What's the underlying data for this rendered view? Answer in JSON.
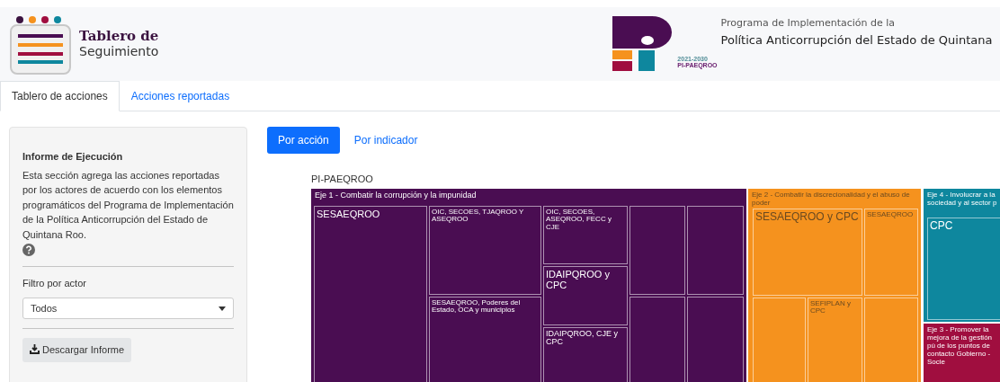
{
  "header": {
    "app_title": "Tablero de",
    "app_subtitle": "Seguimiento",
    "program_line1": "Programa de Implementación de la",
    "program_line2": "Política Anticorrupción del Estado de Quintana",
    "logo_years": "2021-2030",
    "logo_code": "PI-PAEQROO"
  },
  "tabs": [
    {
      "label": "Tablero de acciones",
      "selected": true
    },
    {
      "label": "Acciones reportadas",
      "selected": false
    }
  ],
  "sidebar": {
    "title": "Informe de Ejecución",
    "description": "Esta sección agrega las acciones reportadas por los actores de acuerdo con los elementos programáticos del Programa de Implementación de la Política Anticorrupción del Estado de Quintana Roo.",
    "filter_label": "Filtro por actor",
    "filter_value": "Todos",
    "download_button": "Descargar Informe"
  },
  "view_toggle": [
    {
      "label": "Por acción",
      "selected": true
    },
    {
      "label": "Por indicador",
      "selected": false
    }
  ],
  "treemap": {
    "root_label": "PI-PAEQROO",
    "groups": [
      {
        "label": "Eje 1 - Combatir la corrupción y la impunidad",
        "color": "#4a0d52",
        "tiles": [
          {
            "label": "SESAEQROO"
          },
          {
            "label": "OIC, SECOES, TJAQROO Y ASEQROO"
          },
          {
            "label": "SESAEQROO, Poderes del Estado, OCA y municipios"
          },
          {
            "label": "OIC, SECOES, ASEQROO, FECC y CJE"
          },
          {
            "label": "IDAIPQROO y CPC"
          },
          {
            "label": "IDAIPQROO, CJE y CPC"
          }
        ]
      },
      {
        "label": "Eje 2 - Combatir la discrecionalidad y el abuso de poder",
        "color": "#f5921e",
        "tiles": [
          {
            "label": "SESAEQROO y CPC"
          },
          {
            "label": "SESAEQROO"
          },
          {
            "label": "SEFIPLAN y CPC"
          }
        ]
      },
      {
        "label": "Eje 4 - Involucrar a la sociedad y al sector p",
        "color": "#0e879e",
        "tiles": [
          {
            "label": "CPC"
          }
        ]
      },
      {
        "label": "Eje 3 - Promover la mejora de la gestión pú de los puntos de contacto Gobierno - Socie",
        "color": "#a00e3f"
      }
    ]
  }
}
